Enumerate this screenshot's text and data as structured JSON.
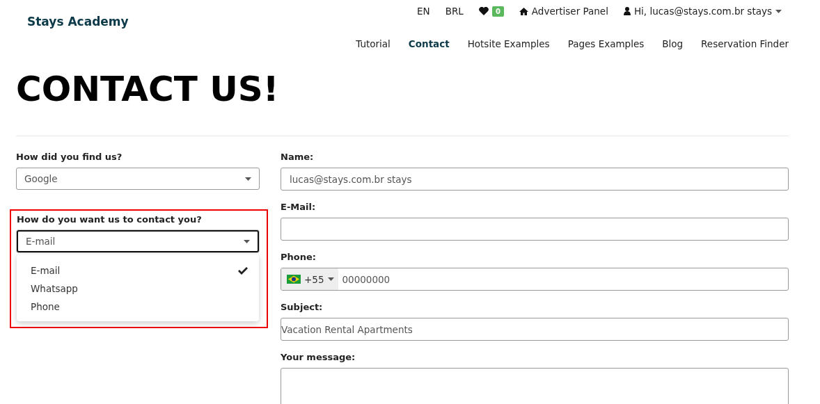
{
  "brand": "Stays Academy",
  "top_links": [
    {
      "kind": "text",
      "label": "EN"
    },
    {
      "kind": "text",
      "label": "BRL"
    },
    {
      "kind": "favorites",
      "label": "0"
    },
    {
      "kind": "home",
      "label": "Advertiser Panel"
    },
    {
      "kind": "user",
      "label": "Hi, lucas@stays.com.br stays"
    }
  ],
  "nav": [
    {
      "label": "Tutorial",
      "selected": false
    },
    {
      "label": "Contact",
      "selected": true
    },
    {
      "label": "Hotsite Examples",
      "selected": false
    },
    {
      "label": "Pages Examples",
      "selected": false
    },
    {
      "label": "Blog",
      "selected": false
    },
    {
      "label": "Reservation Finder",
      "selected": false
    }
  ],
  "title": "CONTACT US!",
  "find_us": {
    "label": "How did you find us?",
    "value": "Google"
  },
  "contact_method": {
    "label": "How do you want us to contact you?",
    "value": "E-mail",
    "highlighted": true,
    "expanded": true,
    "options": [
      {
        "label": "E-mail",
        "selected": true
      },
      {
        "label": "Whatsapp",
        "selected": false
      },
      {
        "label": "Phone",
        "selected": false
      }
    ]
  },
  "fields": [
    {
      "kind": "text",
      "label": "Name:",
      "value": "lucas@stays.com.br stays"
    },
    {
      "kind": "text",
      "label": "E-Mail:"
    },
    {
      "kind": "phone",
      "label": "Phone:",
      "code": "+55",
      "value": "00000000"
    },
    {
      "kind": "flush",
      "label": "Subject:",
      "value": "Vacation Rental Apartments"
    },
    {
      "kind": "textarea",
      "label": "Your message:"
    }
  ]
}
